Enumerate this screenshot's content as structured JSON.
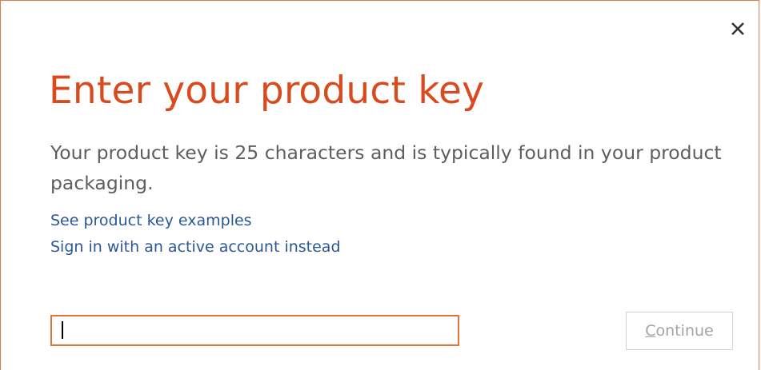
{
  "dialog": {
    "title": "Enter your product key",
    "description": "Your product key is 25 characters and is typically found in your product packaging.",
    "links": [
      {
        "label": "See product key examples"
      },
      {
        "label": "Sign in with an active account instead"
      }
    ],
    "product_key_input": {
      "value": "",
      "placeholder": ""
    },
    "continue_button": {
      "mnemonic": "C",
      "rest": "ontinue",
      "enabled": false
    },
    "close_icon": "close-icon"
  },
  "colors": {
    "accent": "#d94a1e",
    "input_border": "#e8703a",
    "link": "#2b5797",
    "body_text": "#5e5e5e",
    "disabled_text": "#a3a3a3"
  }
}
